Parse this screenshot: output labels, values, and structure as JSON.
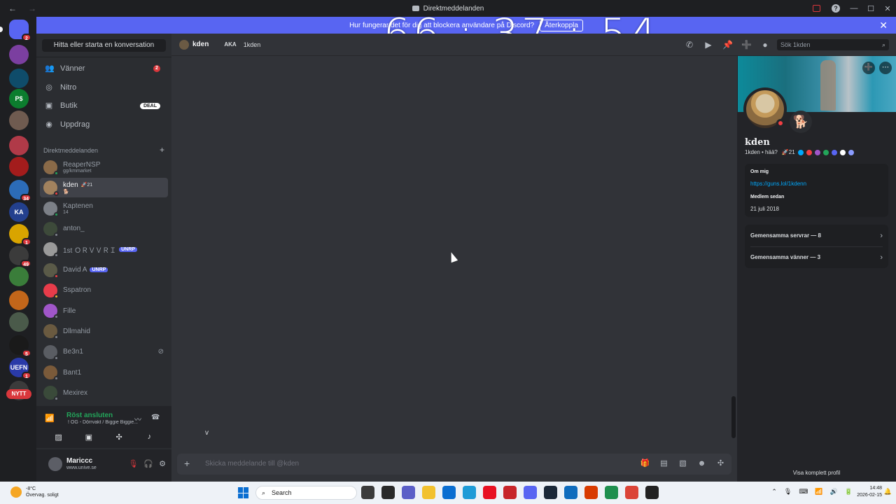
{
  "window": {
    "title": "Direktmeddelanden",
    "back_glyph": "←",
    "forward_glyph": "→",
    "min_glyph": "—",
    "max_glyph": "☐",
    "close_glyph": "✕",
    "help_glyph": "?"
  },
  "banner": {
    "text": "Hur fungerar det för dig att blockera användare på Discord?",
    "button": "Återkoppla",
    "close_glyph": "✕"
  },
  "overlay_timer": "66 : 37 : 54",
  "guilds": [
    {
      "label": "",
      "color": "#5865f2",
      "badge": "2",
      "icon": "discord-home-icon"
    },
    {
      "label": "",
      "color": "#7b3fa0",
      "badge": "",
      "icon": "server-icon"
    },
    {
      "label": "",
      "color": "#0f4c6a",
      "badge": "",
      "icon": "server-icon"
    },
    {
      "label": "P$",
      "color": "#0c7d2e",
      "badge": "",
      "icon": "server-icon"
    },
    {
      "label": "",
      "color": "#6f5b50",
      "badge": "",
      "icon": "server-icon"
    },
    {
      "label": "",
      "color": "#b03a48",
      "badge": "",
      "icon": "server-icon"
    },
    {
      "label": "",
      "color": "#a31c1c",
      "badge": "",
      "icon": "server-icon"
    },
    {
      "label": "",
      "color": "#2c6cb8",
      "badge": "34",
      "icon": "server-icon"
    },
    {
      "label": "KA",
      "color": "#23408e",
      "badge": "",
      "icon": "server-icon"
    },
    {
      "label": "",
      "color": "#d9a400",
      "badge": "1",
      "icon": "server-icon"
    },
    {
      "label": "",
      "color": "#3b3b3b",
      "badge": "49",
      "icon": "server-icon"
    },
    {
      "label": "",
      "color": "#3a7d3a",
      "badge": "",
      "icon": "server-icon"
    },
    {
      "label": "",
      "color": "#c2661a",
      "badge": "",
      "icon": "server-icon"
    },
    {
      "label": "",
      "color": "#4a5a4a",
      "badge": "",
      "icon": "server-icon"
    },
    {
      "label": "",
      "color": "#1a1a1a",
      "badge": "5",
      "icon": "server-icon"
    },
    {
      "label": "UEFN",
      "color": "#2a3aa8",
      "badge": "1",
      "icon": "server-icon"
    },
    {
      "label": "",
      "color": "#3b3b3b",
      "badge": "",
      "icon": "server-icon"
    }
  ],
  "guild_new_label": "NYTT",
  "sidebar": {
    "search_label": "Hitta eller starta en konversation",
    "nav": [
      {
        "label": "Vänner",
        "icon": "friends-icon",
        "glyph": "👥",
        "count": "2"
      },
      {
        "label": "Nitro",
        "icon": "nitro-icon",
        "glyph": "◎"
      },
      {
        "label": "Butik",
        "icon": "shop-icon",
        "glyph": "▣",
        "deal": "DEAL"
      },
      {
        "label": "Uppdrag",
        "icon": "quests-icon",
        "glyph": "◉"
      }
    ],
    "dm_header": "Direktmeddelanden",
    "dm_plus": "+",
    "dms": [
      {
        "name": "ReaperNSP",
        "sub": "gg/kmmarket",
        "avatar": "#8a6a48",
        "status": "#23a55a",
        "tag": "",
        "boost": ""
      },
      {
        "name": "kden",
        "sub": "🐕",
        "avatar": "#a2825e",
        "status": "#f23f43",
        "tag": "",
        "boost": "🚀21",
        "active": true
      },
      {
        "name": "Kaptenen",
        "sub": "14",
        "avatar": "#7c8087",
        "status": "#23a55a",
        "tag": "",
        "boost": ""
      },
      {
        "name": "anton_",
        "sub": "",
        "avatar": "#3d4a3a",
        "status": "#80848e",
        "tag": "",
        "boost": ""
      },
      {
        "name": "1st ＯＲＶＶＲＩ",
        "sub": "",
        "avatar": "#9a9a9a",
        "status": "#80848e",
        "tag": "UNRP",
        "boost": ""
      },
      {
        "name": "David A",
        "sub": "",
        "avatar": "#5a5a48",
        "status": "#f23f43",
        "tag": "UNRP",
        "boost": ""
      },
      {
        "name": "Sspatron",
        "sub": "",
        "avatar": "#e83c4a",
        "status": "#f0b232",
        "tag": "",
        "boost": ""
      },
      {
        "name": "Fille",
        "sub": "",
        "avatar": "#a056c9",
        "status": "#80848e",
        "tag": "",
        "boost": ""
      },
      {
        "name": "Dllmahid",
        "sub": "",
        "avatar": "#6a5a40",
        "status": "#80848e",
        "tag": "",
        "boost": ""
      },
      {
        "name": "Be3n1",
        "sub": "",
        "avatar": "#5a5d63",
        "status": "#80848e",
        "tag": "",
        "boost": "",
        "blocked": "⊘"
      },
      {
        "name": "Bant1",
        "sub": "",
        "avatar": "#7a5a3a",
        "status": "#80848e",
        "tag": "",
        "boost": ""
      },
      {
        "name": "Mexirex",
        "sub": "",
        "avatar": "#3a4a3a",
        "status": "#80848e",
        "tag": "",
        "boost": ""
      }
    ],
    "voice": {
      "status": "Röst ansluten",
      "channel": "! OG - Dörrvakt / Biggie Biggie...",
      "signal_glyph": "📶",
      "noise_glyph": "〰",
      "disconnect_glyph": "☎",
      "actions": [
        {
          "name": "camera-off-icon",
          "glyph": "▨"
        },
        {
          "name": "screen-share-icon",
          "glyph": "▣"
        },
        {
          "name": "activity-icon",
          "glyph": "✣"
        },
        {
          "name": "soundboard-icon",
          "glyph": "♪"
        }
      ]
    },
    "user": {
      "name": "Mariccc",
      "status": "www.unive.se",
      "mute_glyph": "🎙",
      "deafen_glyph": "🎧",
      "settings_glyph": "⚙"
    }
  },
  "chat": {
    "name": "kden",
    "aka_label": "AKA",
    "aka_name": "1kden",
    "search_placeholder": "Sök 1kden",
    "header_icons": [
      {
        "name": "voice-call-icon",
        "glyph": "✆"
      },
      {
        "name": "video-call-icon",
        "glyph": "▶"
      },
      {
        "name": "pin-icon",
        "glyph": "📌"
      },
      {
        "name": "add-friend-icon",
        "glyph": "➕"
      },
      {
        "name": "profile-toggle-icon",
        "glyph": "●"
      }
    ],
    "typing_text": "v",
    "composer_placeholder": "Skicka meddelande till @kden",
    "composer_plus": "+",
    "composer_icons": [
      {
        "name": "gift-icon",
        "glyph": "🎁"
      },
      {
        "name": "gif-icon",
        "glyph": "▤"
      },
      {
        "name": "sticker-icon",
        "glyph": "▧"
      },
      {
        "name": "emoji-icon",
        "glyph": "☻"
      },
      {
        "name": "apps-icon",
        "glyph": "✣"
      }
    ]
  },
  "profile": {
    "name": "kden",
    "line": "1kden • hää?",
    "boost": "🚀21",
    "badge_colors": [
      "#00a8fc",
      "#f23f43",
      "#a056c9",
      "#23a55a",
      "#5865f2",
      "#ffffff",
      "#8a9cff"
    ],
    "about_label": "Om mig",
    "link": "https://guns.lol/1kdenn",
    "member_since_label": "Medlem sedan",
    "member_since": "21 juli 2018",
    "mutual_servers": "Gemensamma servrar — 8",
    "mutual_friends": "Gemensamma vänner — 3",
    "full_profile": "Visa komplett profil",
    "deco_glyph": "🐕",
    "banner_icons": [
      {
        "name": "add-friend-icon",
        "glyph": "➕"
      },
      {
        "name": "more-icon",
        "glyph": "⋯"
      }
    ]
  },
  "taskbar": {
    "weather_temp": "-8°C",
    "weather_desc": "Övervag. soligt",
    "search": "Search",
    "search_glyph": "⌕",
    "apps": [
      {
        "name": "task-view-icon",
        "color": "#3b3b3b"
      },
      {
        "name": "obs-icon",
        "color": "#2a2a2a"
      },
      {
        "name": "teams-icon",
        "color": "#5b5fc7"
      },
      {
        "name": "file-explorer-icon",
        "color": "#f2c12e"
      },
      {
        "name": "store-icon",
        "color": "#0a6ed1"
      },
      {
        "name": "edge-icon",
        "color": "#1e9bd7"
      },
      {
        "name": "app-red-icon",
        "color": "#e81123"
      },
      {
        "name": "antivirus-icon",
        "color": "#c7252a"
      },
      {
        "name": "discord-taskbar-icon",
        "color": "#5865f2"
      },
      {
        "name": "steam-icon",
        "color": "#1b2838"
      },
      {
        "name": "outlook-icon",
        "color": "#0f6cbd"
      },
      {
        "name": "office-icon",
        "color": "#d83b01"
      },
      {
        "name": "app-green-icon",
        "color": "#1e8f4e"
      },
      {
        "name": "chrome-icon",
        "color": "#db4437"
      },
      {
        "name": "app-dark-icon",
        "color": "#222222"
      }
    ],
    "tray": [
      "⌃",
      "🎙",
      "⌨",
      "📶",
      "🔊",
      "🔋"
    ],
    "time": "14:48",
    "date": "2026-02-15",
    "bell_glyph": "🔔"
  }
}
